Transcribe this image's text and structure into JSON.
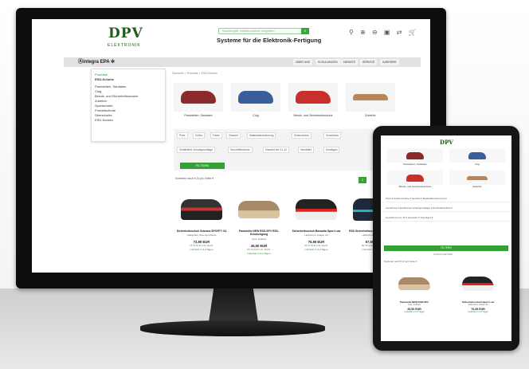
{
  "site": {
    "logo": "DPV",
    "logo_sub": "ELEKTRONIK",
    "tagline": "Systeme für die Elektronik-Fertigung",
    "search_placeholder": "Suchbegriff, Artikelnummer eingeben",
    "header_icons": "⚲ ⊕ ⊖ ▣ ⇄ 🛒",
    "brands": "Ⓐintegra   EPA  ✲"
  },
  "nav": [
    "ÜBER UNS",
    "SCHULUNGEN",
    "DIENSTE",
    "SERVICE",
    "KARRIERE"
  ],
  "dropdown": [
    "Produkte",
    "ESD-Schuhe",
    "Pantoletten, Sandalen",
    "Clog",
    "Berufs- und Sicherheitsschuhe",
    "Zubehör",
    "Sportschuhe",
    "Freizeitschuhe",
    "Überschuhe",
    "ESD-Socken"
  ],
  "breadcrumb": "Startseite  >  Produkte  >  ESD-Schuhe",
  "categories": [
    "Pantoletten, Sandalen",
    "Clog",
    "Berufs- und Sicherheitsschuhe",
    "Zubehör"
  ],
  "filters_row1": [
    "Preis",
    "Größe",
    "Farbe",
    "Gewicht",
    "Materialbezeichnung",
    "Zehenschutz",
    "Verschluss"
  ],
  "filters_row2": [
    "Zertifizierte Schutzgrundlage",
    "Durchtrittsschutz",
    "Gewicht bei Gr. 42",
    "Hersteller",
    "Sonstiges"
  ],
  "filter_button": "FILTERN",
  "reset_label": "ZURÜCKSETZEN",
  "sort": "Sortieren nach ▾    24 pro Seite ▾",
  "page_current": "1",
  "products": [
    {
      "name": "Sicherheitsschuh Sebrana SPORTY S3",
      "desc": "Halbschuh, Boa-Verschluss",
      "price": "72,90 EUR",
      "vat": "75,56 EUR inkl. MwSt.",
      "avail": "Lieferbar in 3-4 Tagen"
    },
    {
      "name": "Pantolette NEW ESD-SPV ESD-Schuhzügung",
      "desc": "Kork, Fußbett",
      "price": "45,50 EUR",
      "vat": "54,15 EUR inkl. MwSt.",
      "avail": "Lieferbar in 3-4 Tagen"
    },
    {
      "name": "Sicherheitsschuh Bavantia Sport Low",
      "desc": "Halbschuh, Klasse S3",
      "price": "76,95 EUR",
      "vat": "91,57 EUR inkl. MwSt.",
      "avail": "Lieferbar in 3-4 Tagen"
    },
    {
      "name": "ESD Sicherheitsschuh Low ventilation",
      "desc": "Halbschuh, Klasse S1",
      "price": "67,55 EUR",
      "vat": "80,39 EUR inkl. MwSt.",
      "avail": "Lieferbar in 3-4 Tagen"
    }
  ],
  "tablet": {
    "categories": [
      "Pantoletten, Sandalen",
      "Clog",
      "Berufs- und Sicherheitsschuhe",
      "Zubehör"
    ],
    "filters": [
      "Preis ▾   Größe ▾   Farbe ▾   Gewicht ▾   Materialbezeichnung ▾",
      "Verschluss ▾   Zertifizierte Schutzgrundlage ▾   Durchtrittsschutz ▾",
      "Gewicht bei Gr. 42 ▾   Hersteller ▾   Sonstiges ▾"
    ],
    "filter_button": "FILTERN",
    "reset_label": "ZURÜCKSETZEN",
    "sort": "Sortieren nach ▾    24 pro Seite ▾",
    "products": [
      {
        "name": "Pantolette NEW ESD-SPV",
        "desc": "Kork, Fußbett",
        "price": "45,50 EUR",
        "avail": "Lieferbar in 3-4 Tagen"
      },
      {
        "name": "Sicherheitsschuh Sport Low",
        "desc": "Halbschuh, Klasse S3",
        "price": "76,95 EUR",
        "avail": "Lieferbar in 3-4 Tagen"
      }
    ]
  }
}
